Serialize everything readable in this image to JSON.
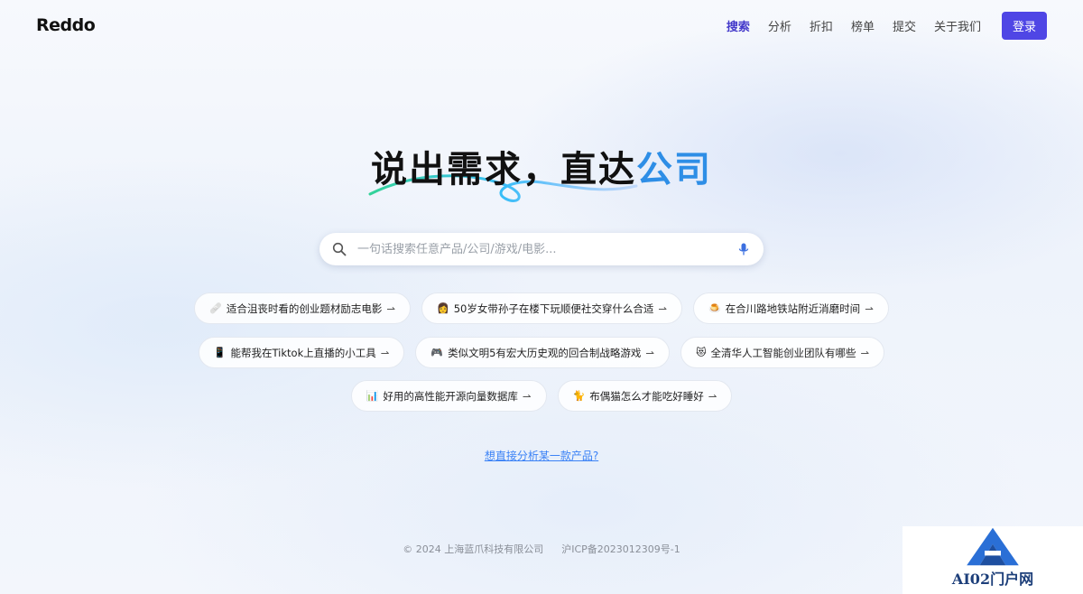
{
  "header": {
    "logo": "Reddo",
    "nav": [
      "搜索",
      "分析",
      "折扣",
      "榜单",
      "提交",
      "关于我们"
    ],
    "login": "登录"
  },
  "hero": {
    "title_main": "说出需求，直达",
    "title_accent": "公司"
  },
  "search": {
    "placeholder": "一句话搜索任意产品/公司/游戏/电影..."
  },
  "suggestions": [
    {
      "emoji": "🩹",
      "text": "适合沮丧时看的创业题材励志电影"
    },
    {
      "emoji": "👩",
      "text": "50岁女带孙子在楼下玩顺便社交穿什么合适"
    },
    {
      "emoji": "🍮",
      "text": "在合川路地铁站附近消磨时间"
    },
    {
      "emoji": "📱",
      "text": "能帮我在Tiktok上直播的小工具"
    },
    {
      "emoji": "🎮",
      "text": "类似文明5有宏大历史观的回合制战略游戏"
    },
    {
      "emoji": "😻",
      "text": "全清华人工智能创业团队有哪些"
    },
    {
      "emoji": "📊",
      "text": "好用的高性能开源向量数据库"
    },
    {
      "emoji": "🐈",
      "text": "布偶猫怎么才能吃好睡好"
    }
  ],
  "arrow": "⇀",
  "analyze_link": "想直接分析某一款产品?",
  "footer": {
    "copyright": "© 2024 上海蓝爪科技有限公司",
    "icp": "沪ICP备2023012309号-1"
  },
  "watermark": {
    "text": "AI02门户网"
  },
  "colors": {
    "accent": "#4f46e5",
    "title_accent": "#2e8ee6",
    "link": "#3b82f6"
  }
}
